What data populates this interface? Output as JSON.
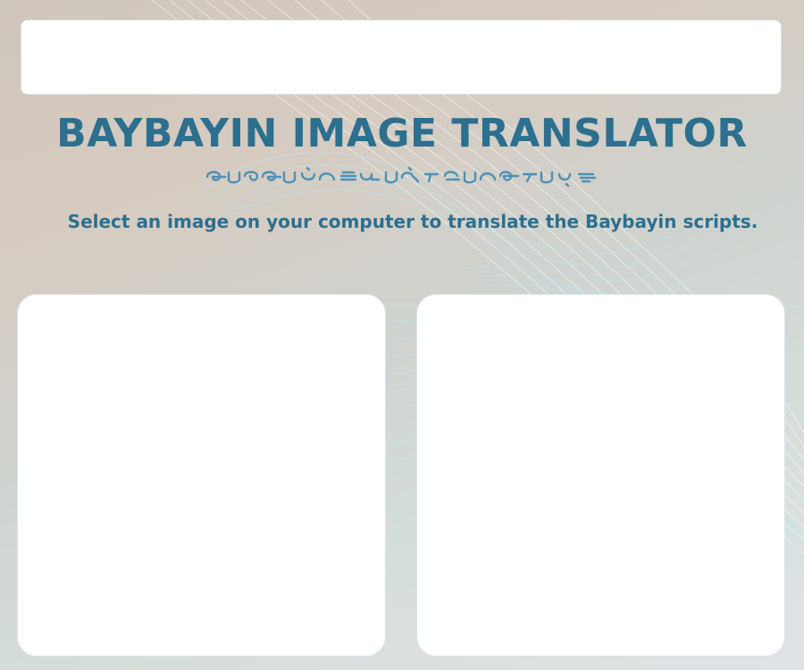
{
  "app": {
    "title": "BAYBAYIN IMAGE TRANSLATOR",
    "subtitle": "Select an image on your computer to translate the Baybayin scripts."
  },
  "decoration": {
    "script_line_icon": "baybayin-script-icon",
    "background_icon": "wave-lines-icon"
  },
  "colors": {
    "accent": "#2c6f8e",
    "script": "#4e90b7",
    "panel": "#ffffff"
  }
}
